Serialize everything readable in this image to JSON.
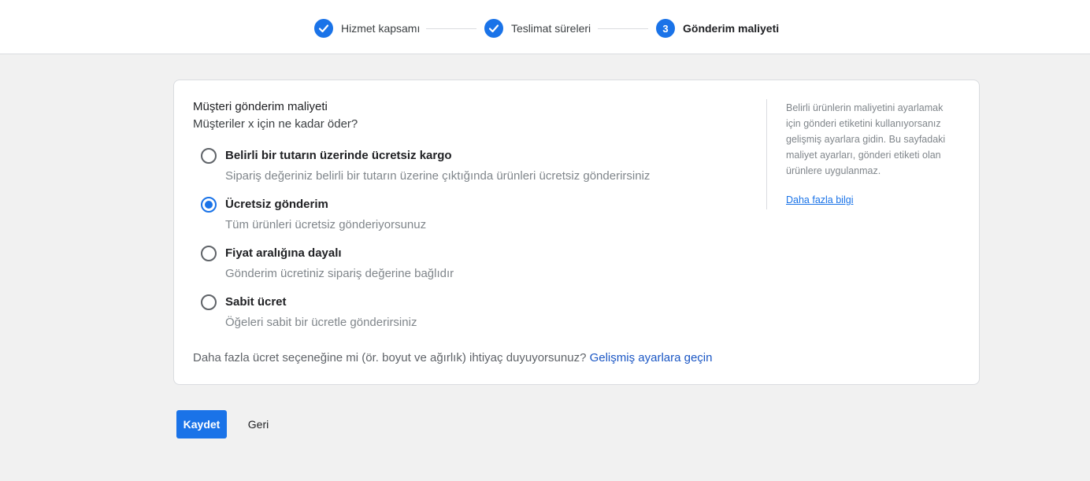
{
  "stepper": {
    "steps": [
      {
        "number": "",
        "label": "Hizmet kapsamı",
        "state": "done"
      },
      {
        "number": "",
        "label": "Teslimat süreleri",
        "state": "done"
      },
      {
        "number": "3",
        "label": "Gönderim maliyeti",
        "state": "active"
      }
    ]
  },
  "card": {
    "title": "Müşteri gönderim maliyeti",
    "subtitle": "Müşteriler x için ne kadar öder?",
    "options": [
      {
        "label": "Belirli bir tutarın üzerinde ücretsiz kargo",
        "desc": "Sipariş değeriniz belirli bir tutarın üzerine çıktığında ürünleri ücretsiz gönderirsiniz",
        "checked": false
      },
      {
        "label": "Ücretsiz gönderim",
        "desc": "Tüm ürünleri ücretsiz gönderiyorsunuz",
        "checked": true
      },
      {
        "label": "Fiyat aralığına dayalı",
        "desc": "Gönderim ücretiniz sipariş değerine bağlıdır",
        "checked": false
      },
      {
        "label": "Sabit ücret",
        "desc": "Öğeleri sabit bir ücretle gönderirsiniz",
        "checked": false
      }
    ],
    "footer_text": "Daha fazla ücret seçeneğine mi (ör. boyut ve ağırlık) ihtiyaç duyuyorsunuz? ",
    "footer_link": "Gelişmiş ayarlara geçin"
  },
  "sidebar": {
    "text": "Belirli ürünlerin maliyetini ayarlamak için gönderi etiketini kullanıyorsanız gelişmiş ayarlara gidin. Bu sayfadaki maliyet ayarları, gönderi etiketi olan ürünlere uygulanmaz.",
    "link": "Daha fazla bilgi"
  },
  "actions": {
    "save_label": "Kaydet",
    "back_label": "Geri"
  },
  "colors": {
    "accent": "#1a73e8",
    "background": "#f1f1f1"
  }
}
